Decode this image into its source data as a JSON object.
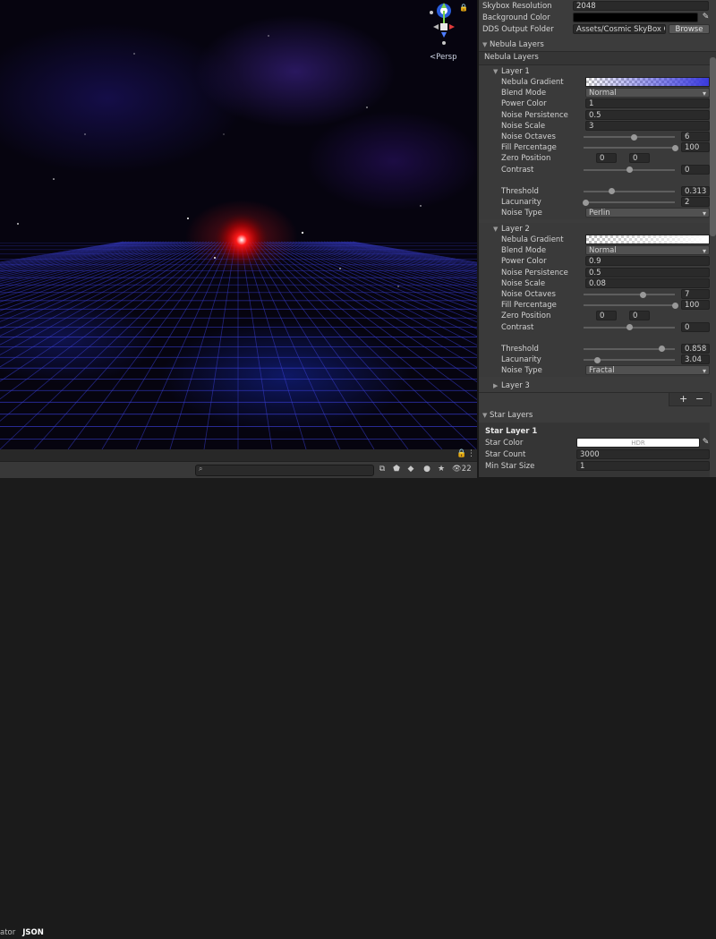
{
  "scene": {
    "view_mode": "<Persp",
    "gizmo_axes": [
      "y",
      "x",
      "z"
    ],
    "grid_color": "#3a3fd8",
    "sun_color": "#ff1a1a"
  },
  "bottom_bar": {
    "search_placeholder": "",
    "visible_count": "22",
    "tabs": [
      "ator",
      "JSON"
    ],
    "active_tab": "JSON"
  },
  "inspector": {
    "top_fields": [
      {
        "label": "Skybox Resolution",
        "value": "2048"
      },
      {
        "label": "Background Color",
        "value": ""
      },
      {
        "label": "DDS Output Folder",
        "value": "Assets/Cosmic SkyBox Ge",
        "button": "Browse"
      }
    ],
    "nebula_section_title": "Nebula Layers",
    "nebula_list_title": "Nebula Layers",
    "layers": [
      {
        "title": "Layer 1",
        "gradient_label": "Nebula Gradient",
        "gradient_color": "#3a3adc",
        "blend_mode_label": "Blend Mode",
        "blend_mode": "Normal",
        "power_color_label": "Power Color",
        "power_color": "1",
        "noise_persistence_label": "Noise Persistence",
        "noise_persistence": "0.5",
        "noise_scale_label": "Noise Scale",
        "noise_scale": "3",
        "noise_octaves_label": "Noise Octaves",
        "noise_octaves": "6",
        "noise_octaves_fraction": 0.55,
        "fill_percentage_label": "Fill Percentage",
        "fill_percentage": "100",
        "fill_percentage_fraction": 1.0,
        "zero_position_label": "Zero Position",
        "zero_position_x": "0",
        "zero_position_y": "0",
        "contrast_label": "Contrast",
        "contrast": "0",
        "contrast_fraction": 0.5,
        "threshold_label": "Threshold",
        "threshold": "0.313",
        "threshold_fraction": 0.313,
        "lacunarity_label": "Lacunarity",
        "lacunarity": "2",
        "lacunarity_fraction": 0.02,
        "noise_type_label": "Noise Type",
        "noise_type": "Perlin"
      },
      {
        "title": "Layer 2",
        "gradient_label": "Nebula Gradient",
        "gradient_color": "#ffffff",
        "blend_mode_label": "Blend Mode",
        "blend_mode": "Normal",
        "power_color_label": "Power Color",
        "power_color": "0.9",
        "noise_persistence_label": "Noise Persistence",
        "noise_persistence": "0.5",
        "noise_scale_label": "Noise Scale",
        "noise_scale": "0.08",
        "noise_octaves_label": "Noise Octaves",
        "noise_octaves": "7",
        "noise_octaves_fraction": 0.65,
        "fill_percentage_label": "Fill Percentage",
        "fill_percentage": "100",
        "fill_percentage_fraction": 1.0,
        "zero_position_label": "Zero Position",
        "zero_position_x": "0",
        "zero_position_y": "0",
        "contrast_label": "Contrast",
        "contrast": "0",
        "contrast_fraction": 0.5,
        "threshold_label": "Threshold",
        "threshold": "0.858",
        "threshold_fraction": 0.858,
        "lacunarity_label": "Lacunarity",
        "lacunarity": "3.04",
        "lacunarity_fraction": 0.15,
        "noise_type_label": "Noise Type",
        "noise_type": "Fractal"
      }
    ],
    "layer3_title": "Layer 3",
    "add_label": "+",
    "remove_label": "−",
    "star_section_title": "Star Layers",
    "star_layer_title": "Star Layer 1",
    "star_color_label": "Star Color",
    "star_color_hdr": "HDR",
    "star_count_label": "Star Count",
    "star_count": "3000",
    "min_star_size_label": "Min Star Size",
    "min_star_size": "1"
  }
}
